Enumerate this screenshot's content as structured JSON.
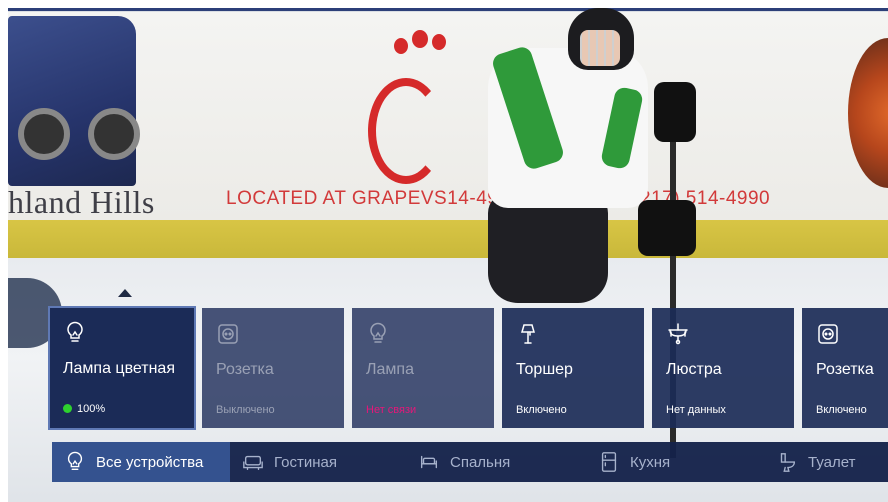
{
  "background": {
    "sign_text": "hland Hills",
    "ad_text": "LOCATED AT GRAPEVS14-4990",
    "phone_text": "217) 514-4990"
  },
  "devices": [
    {
      "name": "Лампа цветная",
      "status": "100%",
      "icon": "lightbulb-icon",
      "state": "on",
      "status_color": "#2ed12e"
    },
    {
      "name": "Розетка",
      "status": "Выключено",
      "icon": "socket-icon",
      "state": "off"
    },
    {
      "name": "Лампа",
      "status": "Нет связи",
      "icon": "lightbulb-icon",
      "state": "offline",
      "status_color": "#e5177a"
    },
    {
      "name": "Торшер",
      "status": "Включено",
      "icon": "floor-lamp-icon",
      "state": "on"
    },
    {
      "name": "Люстра",
      "status": "Нет данных",
      "icon": "chandelier-icon",
      "state": "unknown"
    },
    {
      "name": "Розетка",
      "status": "Включено",
      "icon": "socket-icon",
      "state": "on"
    }
  ],
  "rooms": [
    {
      "label": "Все устройства",
      "icon": "lightbulb-icon",
      "active": true
    },
    {
      "label": "Гостиная",
      "icon": "sofa-icon",
      "active": false
    },
    {
      "label": "Спальня",
      "icon": "bed-icon",
      "active": false
    },
    {
      "label": "Кухня",
      "icon": "fridge-icon",
      "active": false
    },
    {
      "label": "Туалет",
      "icon": "toilet-icon",
      "active": false
    }
  ],
  "colors": {
    "panel": "#1b2b57",
    "accent_tab": "#34528f",
    "online_dot": "#2ed12e",
    "error_text": "#e5177a"
  }
}
